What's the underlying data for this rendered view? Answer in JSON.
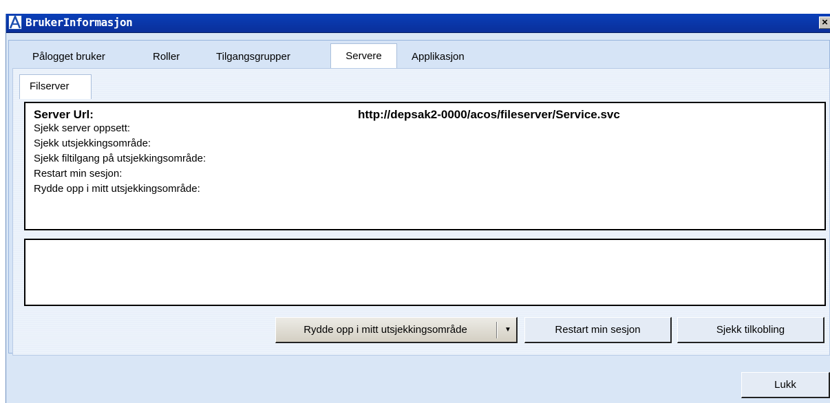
{
  "window": {
    "title": "BrukerInformasjon",
    "close_label": "×"
  },
  "tabs": [
    {
      "label": "Pålogget bruker"
    },
    {
      "label": "Roller"
    },
    {
      "label": "Tilgangsgrupper"
    },
    {
      "label": "Servere",
      "active": true
    },
    {
      "label": "Applikasjon"
    }
  ],
  "subtabs": [
    {
      "label": "Filserver",
      "active": true
    }
  ],
  "info": {
    "server_url_label": "Server Url:",
    "server_url_value": "http://depsak2-0000/acos/fileserver/Service.svc",
    "lines": [
      "Sjekk server oppsett:",
      "Sjekk utsjekkingsområde:",
      "Sjekk filtilgang på utsjekkingsområde:",
      "Restart min sesjon:",
      "Rydde opp i mitt utsjekkingsområde:"
    ]
  },
  "output": {
    "text": ""
  },
  "buttons": {
    "cleanup": "Rydde opp i mitt utsjekkingsområde",
    "restart": "Restart min sesjon",
    "check": "Sjekk tilkobling",
    "close": "Lukk"
  },
  "icons": {
    "app": "acos-a-icon",
    "dropdown": "chevron-down-icon"
  }
}
